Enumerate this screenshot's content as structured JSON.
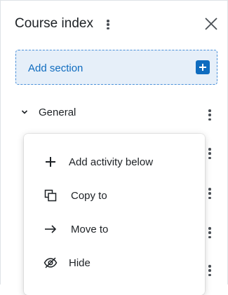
{
  "course_index": {
    "title": "Course index",
    "add_section_label": "Add section",
    "section_name": "General"
  },
  "menu": {
    "items": [
      {
        "label": "Add activity below",
        "icon": "plus-icon"
      },
      {
        "label": "Copy to",
        "icon": "copy-icon"
      },
      {
        "label": "Move to",
        "icon": "arrow-right-icon"
      },
      {
        "label": "Hide",
        "icon": "eye-slash-icon"
      }
    ]
  },
  "colors": {
    "accent": "#0f6cbf",
    "add_section_bg": "#e6eff9",
    "text": "#1d2125"
  }
}
